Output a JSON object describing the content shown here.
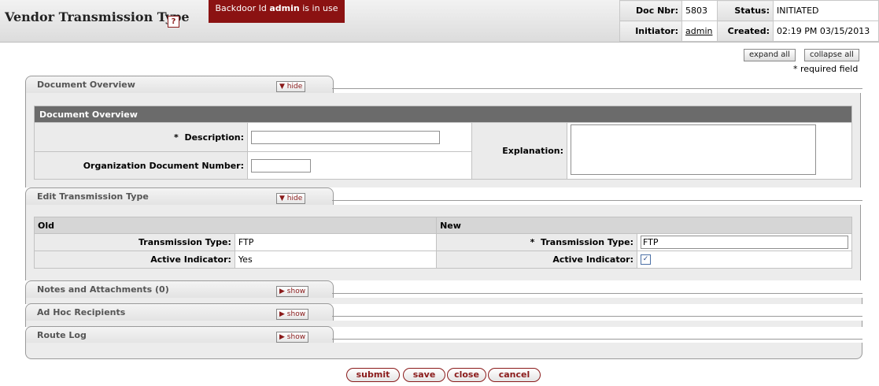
{
  "header": {
    "title": "Vendor Transmission Type",
    "help_icon": "?",
    "backdoor_prefix": "Backdoor Id",
    "backdoor_user": "admin",
    "backdoor_suffix": "is in use",
    "doc_nbr_label": "Doc Nbr:",
    "doc_nbr": "5803",
    "status_label": "Status:",
    "status": "INITIATED",
    "initiator_label": "Initiator:",
    "initiator": "admin",
    "created_label": "Created:",
    "created": "02:19 PM 03/15/2013"
  },
  "controls": {
    "expand_all": "expand all",
    "collapse_all": "collapse all",
    "required_note": "* required field"
  },
  "document_overview": {
    "tab_title": "Document Overview",
    "toggle": "hide",
    "section_title": "Document Overview",
    "description_label": "Description:",
    "required_marker": "*",
    "description_value": "",
    "org_doc_label": "Organization Document Number:",
    "org_doc_value": "",
    "explanation_label": "Explanation:",
    "explanation_value": ""
  },
  "edit_transmission": {
    "tab_title": "Edit Transmission Type",
    "toggle": "hide",
    "old_label": "Old",
    "new_label": "New",
    "transmission_type_label": "Transmission Type:",
    "old_transmission_type": "FTP",
    "new_transmission_type": "FTP",
    "active_indicator_label": "Active Indicator:",
    "old_active": "Yes",
    "new_active_checked": true,
    "required_marker": "*"
  },
  "notes": {
    "tab_title": "Notes and Attachments (0)",
    "toggle": "show"
  },
  "adhoc": {
    "tab_title": "Ad Hoc Recipients",
    "toggle": "show"
  },
  "routelog": {
    "tab_title": "Route Log",
    "toggle": "show"
  },
  "actions": {
    "submit": "submit",
    "save": "save",
    "close": "close",
    "cancel": "cancel"
  },
  "icons": {
    "hide_arrow": "▼",
    "show_arrow": "▶",
    "check": "✓"
  }
}
